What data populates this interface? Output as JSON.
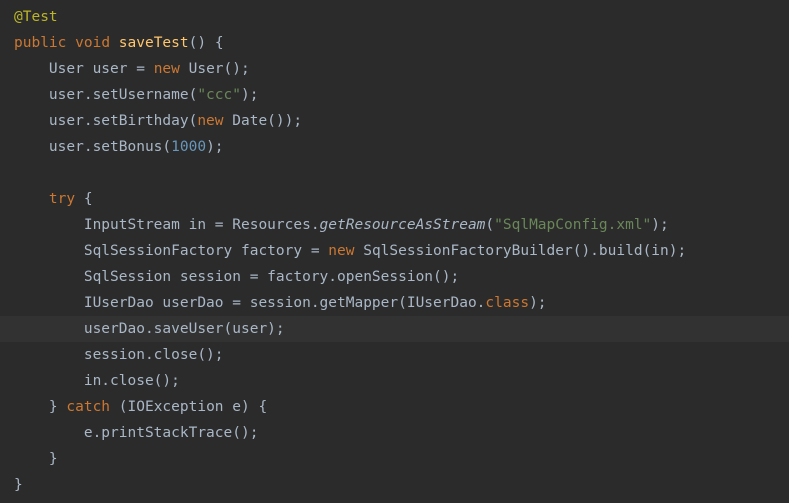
{
  "code": {
    "annotation": "@Test",
    "kw_public": "public",
    "kw_void": "void",
    "method_name": "saveTest",
    "empty_parens": "()",
    "space": " ",
    "brace_open": "{",
    "brace_close": "}",
    "indent1": "    ",
    "indent2": "        ",
    "l3_a": "User user = ",
    "kw_new": "new",
    "l3_b": " User();",
    "l4_a": "user.setUsername(",
    "str_ccc": "\"ccc\"",
    "l4_b": ");",
    "l5_a": "user.setBirthday(",
    "l5_b": " Date());",
    "l6_a": "user.setBonus(",
    "num_1000": "1000",
    "l6_b": ");",
    "kw_try": "try",
    "l9_a": "InputStream in = Resources.",
    "l9_stat": "getResourceAsStream",
    "l9_b": "(",
    "str_cfg": "\"SqlMapConfig.xml\"",
    "l9_c": ");",
    "l10_a": "SqlSessionFactory factory = ",
    "l10_b": " SqlSessionFactoryBuilder().build(in);",
    "l11": "SqlSession session = factory.openSession();",
    "l12_a": "IUserDao userDao = session.getMapper(IUserDao.",
    "kw_class": "class",
    "l12_b": ");",
    "l13": "userDao.saveUser(user);",
    "l14": "session.close();",
    "l15": "in.close();",
    "l16_a": "} ",
    "kw_catch": "catch",
    "l16_b": " (IOException e) {",
    "l17": "e.printStackTrace();"
  }
}
